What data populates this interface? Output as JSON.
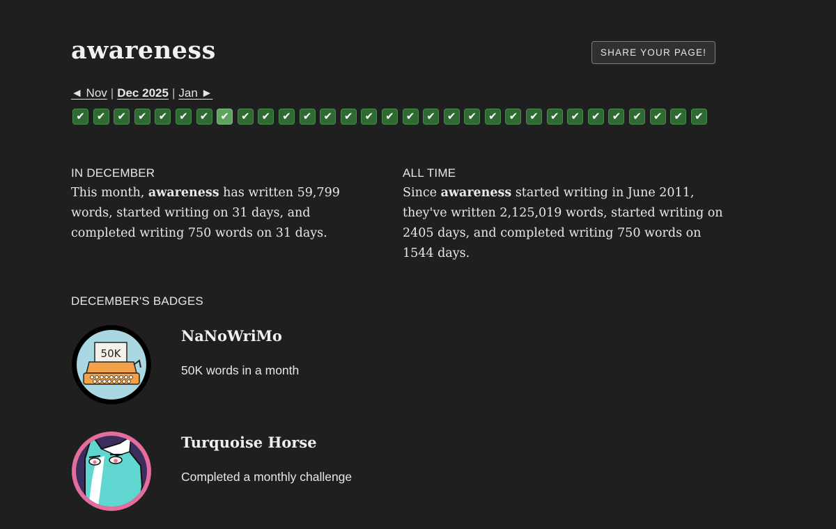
{
  "username": "awareness",
  "share_button": "SHARE YOUR PAGE!",
  "month_nav": {
    "prev": "◄ Nov",
    "current": "Dec 2025",
    "next": "Jan ►",
    "separator": "|"
  },
  "days": {
    "check_glyph": "✔",
    "count": 31,
    "highlighted_day": 8
  },
  "month_stats": {
    "label": "IN DECEMBER",
    "prefix": "This month, ",
    "name": "awareness",
    "suffix": " has written 59,799 words, started writing on 31 days, and completed writing 750 words on 31 days."
  },
  "alltime_stats": {
    "label": "ALL TIME",
    "prefix": "Since ",
    "name": "awareness",
    "suffix": " started writing in June 2011, they've written 2,125,019 words, started writing on 2405 days, and completed writing 750 words on 1544 days."
  },
  "badges": {
    "label": "DECEMBER'S BADGES",
    "items": [
      {
        "title": "NaNoWriMo",
        "description": "50K words in a month",
        "image_text": "50K",
        "icon": "typewriter-icon"
      },
      {
        "title": "Turquoise Horse",
        "description": "Completed a monthly challenge",
        "icon": "horse-icon"
      }
    ]
  },
  "colors": {
    "background": "#1f1f1f",
    "check_green": "#2f6a33",
    "check_highlight": "#5fa35f",
    "badge1_bg": "#a9d8e3",
    "badge1_typewriter": "#f3a24a",
    "badge2_ring": "#e46d9e",
    "badge2_horse": "#5fd6cf",
    "badge2_bg": "#3a2f5c"
  }
}
